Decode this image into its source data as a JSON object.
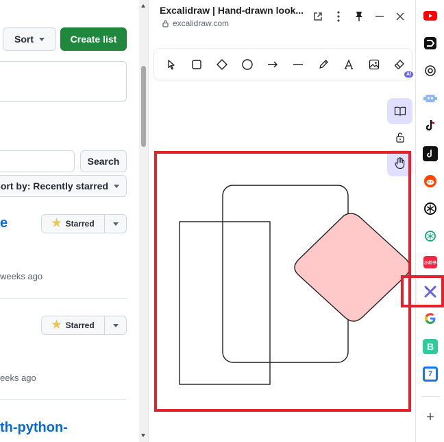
{
  "github": {
    "sort_label": "Sort",
    "create_list_label": "Create list",
    "search_button_label": "Search",
    "sort_by_label": "Sort by: Recently starred",
    "repos": [
      {
        "name_fragment": "e",
        "starred_label": "Starred",
        "updated": "weeks ago"
      },
      {
        "name_fragment": "",
        "starred_label": "Starred",
        "updated": "eeks ago"
      },
      {
        "name_fragment": "th-python-",
        "starred_label": "",
        "updated": ""
      }
    ]
  },
  "panel": {
    "title": "Excalidraw | Hand-drawn look...",
    "url": "excalidraw.com",
    "tools": [
      "selection-tool",
      "rectangle-tool",
      "diamond-tool",
      "ellipse-tool",
      "arrow-tool",
      "line-tool",
      "draw-tool",
      "text-tool",
      "image-tool",
      "eraser-tool"
    ],
    "ai_badge": "AI",
    "side_tools": [
      "library-icon",
      "unlock-icon",
      "hand-icon"
    ]
  },
  "canvas": {
    "shapes": [
      {
        "type": "rectangle",
        "stroke": "#1e1e1e",
        "fill": "none"
      },
      {
        "type": "rounded-rectangle",
        "stroke": "#1e1e1e",
        "fill": "none"
      },
      {
        "type": "diamond",
        "stroke": "#1e1e1e",
        "fill": "#ffc9c9"
      }
    ]
  },
  "rail": {
    "icons": [
      "youtube-icon",
      "readwise-icon",
      "chatgpt-icon",
      "robot-icon",
      "tiktok-icon",
      "tiktok-alt-icon",
      "reddit-icon",
      "openai-icon",
      "chatgpt-green-icon",
      "xiaohongshu-icon",
      "excalidraw-icon",
      "google-icon",
      "bing-icon",
      "calendar-icon"
    ],
    "xiaohongshu_text": "小红书",
    "bing_text": "B",
    "calendar_text": "7",
    "add_label": "+"
  },
  "colors": {
    "accent": "#6965db",
    "highlight": "#e0232d",
    "github_green": "#1f883d",
    "link": "#0969da"
  }
}
